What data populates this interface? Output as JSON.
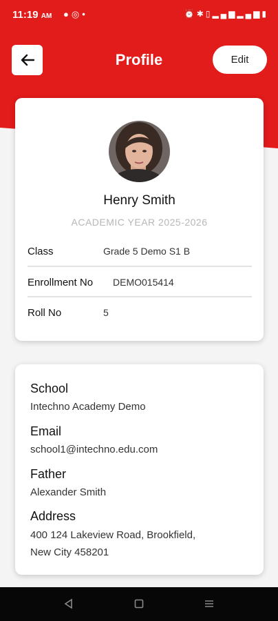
{
  "status_bar": {
    "time": "11:19",
    "ampm": "AM",
    "left_icons": [
      "chat-icon",
      "whatsapp-icon",
      "dot-icon"
    ],
    "right_icons": [
      "alarm-icon",
      "bluetooth-icon",
      "vibrate-icon",
      "signal-icon",
      "signal-icon",
      "battery-icon"
    ]
  },
  "header": {
    "title": "Profile",
    "edit_label": "Edit",
    "back_icon": "arrow-left-icon"
  },
  "profile": {
    "name": "Henry Smith",
    "academic_year": "ACADEMIC YEAR 2025-2026",
    "rows": [
      {
        "label": "Class",
        "value": "Grade 5 Demo S1 B"
      },
      {
        "label": "Enrollment No",
        "value": "DEMO015414"
      },
      {
        "label": "Roll No",
        "value": "5"
      }
    ]
  },
  "details": {
    "school_label": "School",
    "school_value": "Intechno Academy Demo",
    "email_label": "Email",
    "email_value": "school1@intechno.edu.com",
    "father_label": "Father",
    "father_value": "Alexander Smith",
    "address_label": "Address",
    "address_line1": "400 124 Lakeview Road, Brookfield,",
    "address_line2": "New City 458201"
  },
  "colors": {
    "brand_red": "#e21b1b",
    "card_bg": "#ffffff",
    "nav_bg": "#070707"
  }
}
